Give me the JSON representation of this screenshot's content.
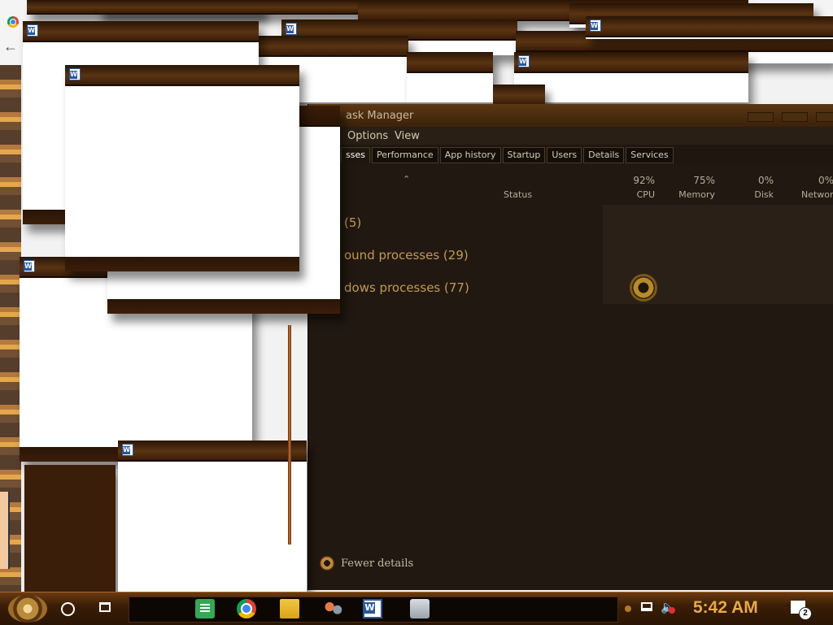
{
  "task_manager": {
    "title": "ask Manager",
    "menu": [
      "Options",
      "View"
    ],
    "tabs": [
      "sses",
      "Performance",
      "App history",
      "Startup",
      "Users",
      "Details",
      "Services"
    ],
    "columns": [
      {
        "pct": "92%",
        "name": "CPU"
      },
      {
        "pct": "75%",
        "name": "Memory"
      },
      {
        "pct": "0%",
        "name": "Disk"
      },
      {
        "pct": "0%",
        "name": "Network"
      }
    ],
    "status_header": "Status",
    "groups": [
      "(5)",
      "ound processes (29)",
      "dows processes (77)"
    ],
    "fewer_details": "Fewer details"
  },
  "taskbar": {
    "clock": "5:42 AM",
    "notification_count": "2"
  }
}
